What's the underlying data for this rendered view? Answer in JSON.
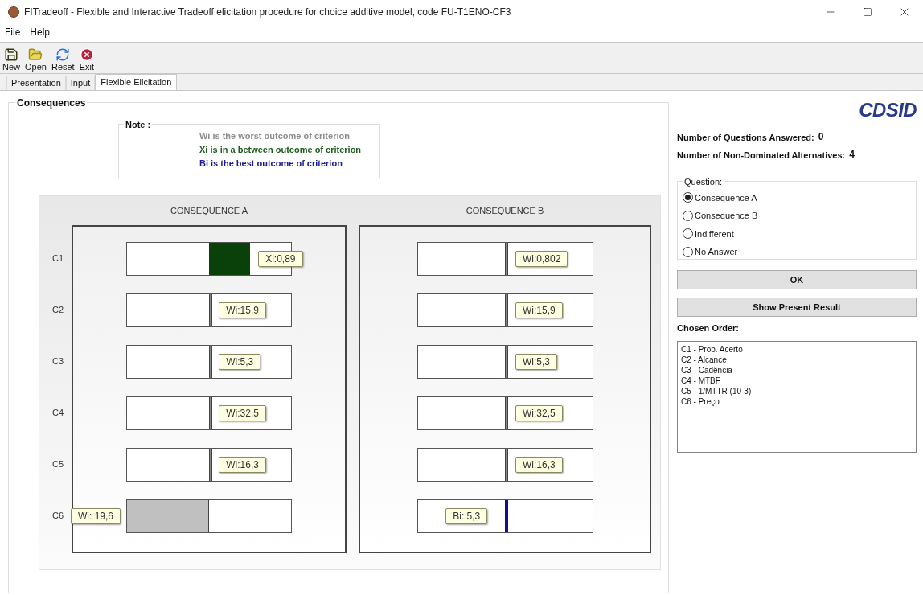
{
  "window": {
    "title": "FITradeoff - Flexible and Interactive Tradeoff elicitation  procedure for choice additive model, code FU-T1ENO-CF3"
  },
  "menu": [
    "File",
    "Help"
  ],
  "toolbar": [
    {
      "label": "New",
      "kind": "new"
    },
    {
      "label": "Open",
      "kind": "open"
    },
    {
      "label": "Reset",
      "kind": "reset"
    },
    {
      "label": "Exit",
      "kind": "exit"
    }
  ],
  "tabs": [
    {
      "label": "Presentation",
      "selected": false
    },
    {
      "label": "Input",
      "selected": false
    },
    {
      "label": "Flexible Elicitation",
      "selected": true
    }
  ],
  "consequences": {
    "title": "Consequences",
    "note": {
      "title": "Note :",
      "lines": [
        {
          "text": "Wi is the worst outcome of criterion",
          "color": "#8c8c8c"
        },
        {
          "text": "Xi is in a between outcome of criterion",
          "color": "#1e5a1e"
        },
        {
          "text": "Bi is the best outcome of criterion",
          "color": "#1a1a8c"
        }
      ]
    },
    "criteria": [
      "C1",
      "C2",
      "C3",
      "C4",
      "C5",
      "C6"
    ],
    "panels": [
      {
        "title": "CONSEQUENCE A",
        "bars": [
          {
            "kind": "xi",
            "tag": "Xi:0,89"
          },
          {
            "kind": "wi",
            "tag": "Wi:15,9"
          },
          {
            "kind": "wi",
            "tag": "Wi:5,3"
          },
          {
            "kind": "wi",
            "tag": "Wi:32,5"
          },
          {
            "kind": "wi",
            "tag": "Wi:16,3"
          },
          {
            "kind": "wi_fill",
            "tag": "Wi: 19,6"
          }
        ]
      },
      {
        "title": "CONSEQUENCE B",
        "bars": [
          {
            "kind": "wi",
            "tag": "Wi:0,802"
          },
          {
            "kind": "wi",
            "tag": "Wi:15,9"
          },
          {
            "kind": "wi",
            "tag": "Wi:5,3"
          },
          {
            "kind": "wi",
            "tag": "Wi:32,5"
          },
          {
            "kind": "wi",
            "tag": "Wi:16,3"
          },
          {
            "kind": "bi",
            "tag": "Bi: 5,3"
          }
        ]
      }
    ]
  },
  "side": {
    "logo": "CDSID",
    "stats": [
      {
        "label": "Number of Questions Answered:",
        "value": "0"
      },
      {
        "label": "Number of Non-Dominated Alternatives:",
        "value": "4"
      }
    ],
    "question": {
      "title": "Question:",
      "options": [
        {
          "label": "Consequence A",
          "selected": true
        },
        {
          "label": "Consequence B",
          "selected": false
        },
        {
          "label": "Indifferent",
          "selected": false
        },
        {
          "label": "No Answer",
          "selected": false
        }
      ]
    },
    "buttons": [
      "OK",
      "Show Present Result"
    ],
    "order": {
      "title": "Chosen Order:",
      "items": [
        "C1 - Prob. Acerto",
        "C2 - Alcance",
        "C3 - Cadência",
        "C4 - MTBF",
        "C5 - 1/MTTR (10-3)",
        "C6 - Preço"
      ]
    }
  }
}
